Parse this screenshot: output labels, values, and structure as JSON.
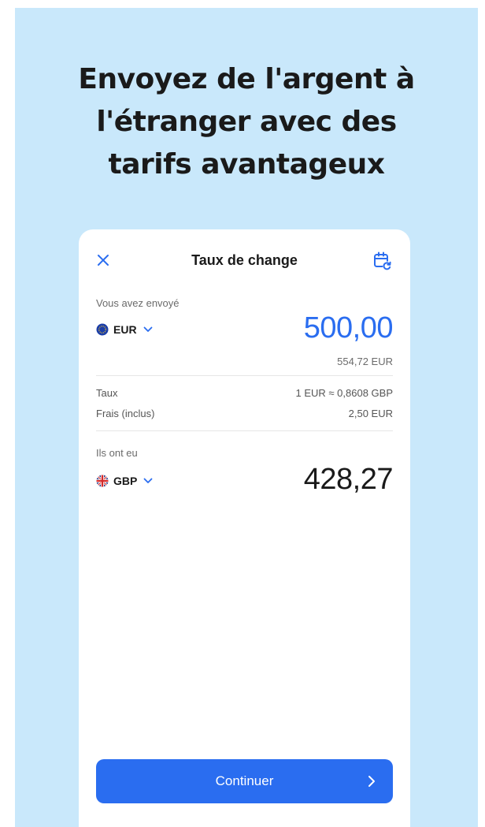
{
  "headline": {
    "line1": "Envoyez de l'argent à",
    "line2": "l'étranger avec des",
    "line3": "tarifs avantageux"
  },
  "screen": {
    "title": "Taux de change",
    "close_icon": "close-icon",
    "calendar_icon": "calendar-refresh-icon"
  },
  "sent": {
    "label": "Vous avez envoyé",
    "currency": "EUR",
    "amount": "500,00",
    "total": "554,72 EUR"
  },
  "details": {
    "rate_label": "Taux",
    "rate_value": "1 EUR ≈ 0,8608 GBP",
    "fee_label": "Frais (inclus)",
    "fee_value": "2,50 EUR"
  },
  "received": {
    "label": "Ils ont eu",
    "currency": "GBP",
    "amount": "428,27"
  },
  "continue_button": {
    "label": "Continuer"
  },
  "colors": {
    "background": "#c9e8fb",
    "accent": "#2a6df0",
    "text": "#1a1a1a"
  }
}
